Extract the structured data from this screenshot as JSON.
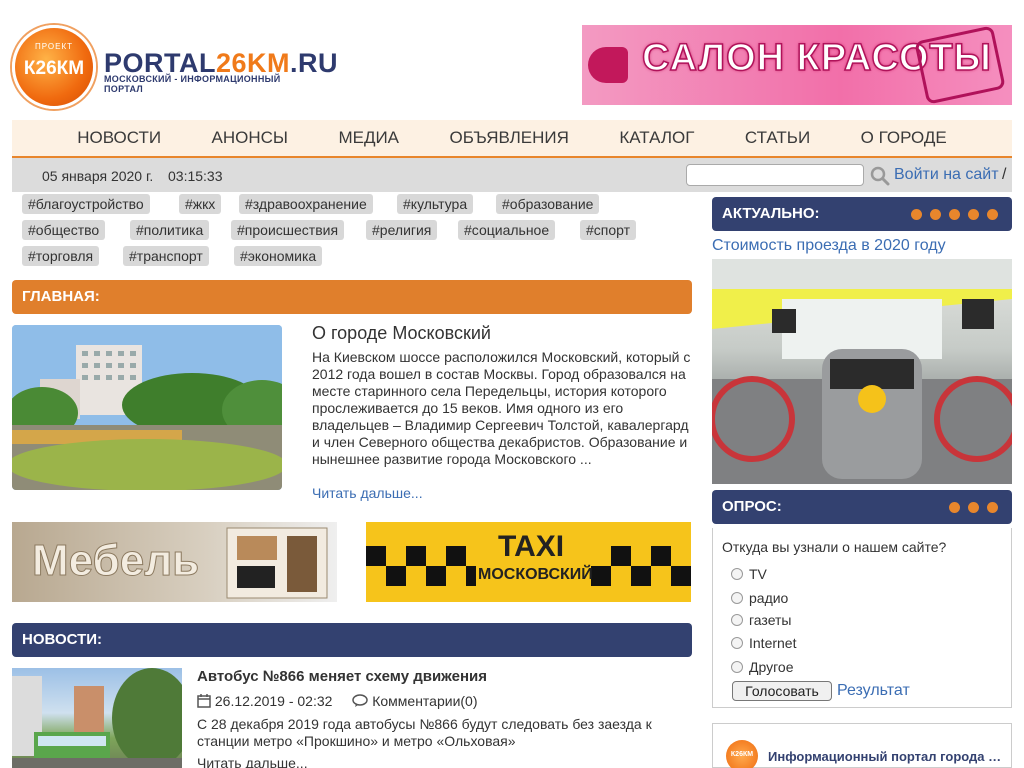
{
  "header": {
    "logo_project": "ПРОЕКТ",
    "logo_badge": "К26КМ",
    "logo_portal_a": "PORTAL",
    "logo_portal_b": "26KM",
    "logo_portal_c": ".RU",
    "logo_subtitle": "МОСКОВСКИЙ - ИНФОРМАЦИОННЫЙ ПОРТАЛ",
    "banner_text": "САЛОН КРАСОТЫ"
  },
  "nav": [
    "НОВОСТИ",
    "АНОНСЫ",
    "МЕДИА",
    "ОБЪЯВЛЕНИЯ",
    "КАТАЛОГ",
    "СТАТЬИ",
    "О ГОРОДЕ"
  ],
  "datebar": {
    "date": "05 января 2020 г.",
    "time": "03:15:33",
    "search_placeholder": "",
    "login": "Войти на сайт",
    "slash": "/"
  },
  "tags": [
    "#благоустройство",
    "#жкх",
    "#здравоохранение",
    "#культура",
    "#образование",
    "#общество",
    "#политика",
    "#происшествия",
    "#религия",
    "#социальное",
    "#спорт",
    "#торговля",
    "#транспорт",
    "#экономика"
  ],
  "main": {
    "header": "ГЛАВНАЯ:",
    "title": "О городе Московский",
    "text": "На Киевском шоссе расположился Московский, который с 2012 года вошел в состав Москвы. Город образовался на месте старинного села Передельцы, история которого прослеживается до 15 веков. Имя одного из его владельцев – Владимир Сергеевич Толстой, кавалергард и член Северного общества декабристов. Образование и нынешнее развитие города Московского ...",
    "more": "Читать дальше..."
  },
  "ads": {
    "furniture": "Мебель",
    "taxi_1": "TAXI",
    "taxi_2": "МОСКОВСКИЙ"
  },
  "news": {
    "header": "НОВОСТИ:",
    "title": "Автобус №866 меняет схему движения",
    "date": "26.12.2019 - 02:32",
    "comments": "Комментарии(0)",
    "text": "С 28 декабря 2019 года автобусы №866 будут следовать без заезда к станции метро «Прокшино» и метро «Ольховая»",
    "more": "Читать дальше..."
  },
  "sidebar": {
    "actual_header": "АКТУАЛЬНО:",
    "actual_link": "Стоимость проезда в 2020 году",
    "poll_header": "ОПРОС:",
    "poll_question": "Откуда вы узнали о нашем сайте?",
    "poll_options": [
      "TV",
      "радио",
      "газеты",
      "Internet",
      "Другое"
    ],
    "vote_button": "Голосовать",
    "result_link": "Результат",
    "fb_logo": "К26КМ",
    "fb_title": "Информационный портал города Московский"
  },
  "colors": {
    "accent_orange": "#e07f2c",
    "navy": "#334170",
    "link_blue": "#3b6db3"
  },
  "icons": [
    "search-icon",
    "calendar-icon",
    "comment-icon"
  ]
}
